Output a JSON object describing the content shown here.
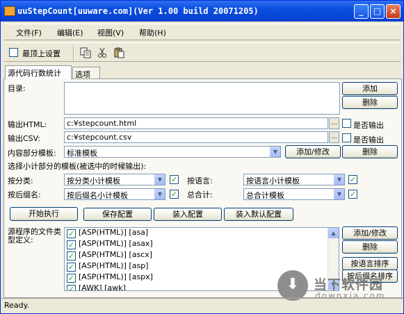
{
  "window": {
    "title": "uuStepCount[uuware.com](Ver 1.00 build 20071205)",
    "status": "Ready."
  },
  "menu": [
    "文件(F)",
    "编辑(E)",
    "视图(V)",
    "帮助(H)"
  ],
  "toolbar": {
    "topmost_label": "最顶上设置",
    "topmost_checked": false
  },
  "tabs": [
    "源代码行数统计",
    "选项"
  ],
  "form": {
    "dir_label": "目录:",
    "add": "添加",
    "remove": "删除",
    "html_label": "输出HTML:",
    "html_value": "c:¥stepcount.html",
    "html_check": "是否输出",
    "csv_label": "输出CSV:",
    "csv_value": "c:¥stepcount.csv",
    "csv_check": "是否输出",
    "template_label": "内容部分模板:",
    "template_value": "标准模板",
    "template_add": "添加/修改",
    "template_remove": "删除",
    "subtotal_label": "选择小计部分的模板(被选中的时候输出):",
    "bytype_label": "按分类:",
    "bytype_value": "按分类小计模板",
    "bylang_label": "按语言:",
    "bylang_value": "按语言小计模板",
    "byext_label": "按后缀名:",
    "byext_value": "按后缀名小计模板",
    "total_label": "总合计:",
    "total_value": "总合计模板",
    "start": "开始执行",
    "save": "保存配置",
    "load": "装入配置",
    "load_default": "装入默认配置",
    "filetypes_label": "源程序的文件类型定义:",
    "filetypes": [
      "[ASP(HTML)] [asa]",
      "[ASP(HTML)] [asax]",
      "[ASP(HTML)] [ascx]",
      "[ASP(HTML)] [asp]",
      "[ASP(HTML)] [aspx]",
      "[AWK] [awk]"
    ],
    "ft_add": "添加/修改",
    "ft_remove": "删除",
    "sort_lang": "按语言排序",
    "sort_ext": "按后缀名排序"
  },
  "watermark": {
    "name": "当下软件园",
    "url": "downxia.com"
  }
}
